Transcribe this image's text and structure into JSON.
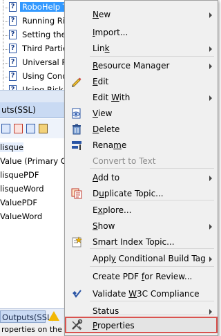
{
  "tree": {
    "items": [
      {
        "label": "RoboHelp Tu",
        "selected": true
      },
      {
        "label": "Running Risk",
        "selected": false
      },
      {
        "label": "Setting the Cu",
        "selected": false
      },
      {
        "label": "Third Parties a",
        "selected": false
      },
      {
        "label": "Universal Ref",
        "selected": false
      },
      {
        "label": "Using Conditio",
        "selected": false
      },
      {
        "label": "Using Risk Se",
        "selected": false
      }
    ],
    "doc_icon_glyph": "?"
  },
  "outputs_pane": {
    "title": "uts(SSL)",
    "items": [
      {
        "label": "lisque",
        "selected": true
      },
      {
        "label": "Value (Primary Output",
        "selected": false
      },
      {
        "label": "lisquePDF",
        "selected": false
      },
      {
        "label": "lisqueWord",
        "selected": false
      },
      {
        "label": "ValuePDF",
        "selected": false
      },
      {
        "label": "ValueWord",
        "selected": false
      }
    ]
  },
  "bottom_tab": {
    "label": "Outputs(SSL)"
  },
  "status_bar": {
    "text": "roperties on the s"
  },
  "context_menu": {
    "items": [
      {
        "label": "New",
        "accel": "N",
        "submenu": true,
        "icon": "",
        "disabled": false
      },
      {
        "label": "Import...",
        "accel": "I",
        "submenu": false,
        "icon": "",
        "disabled": false
      },
      {
        "label": "Link",
        "accel": "k",
        "submenu": true,
        "icon": "",
        "disabled": false
      },
      {
        "label": "Resource Manager",
        "accel": "R",
        "submenu": true,
        "icon": "",
        "disabled": false
      },
      {
        "label": "Edit",
        "accel": "E",
        "submenu": false,
        "icon": "pencil-icon",
        "disabled": false
      },
      {
        "label": "Edit With",
        "accel": "W",
        "submenu": true,
        "icon": "",
        "disabled": false
      },
      {
        "label": "View",
        "accel": "V",
        "submenu": false,
        "icon": "eye-document-icon",
        "disabled": false
      },
      {
        "label": "Delete",
        "accel": "D",
        "submenu": false,
        "icon": "trash-icon",
        "disabled": false
      },
      {
        "label": "Rename",
        "accel": "m",
        "submenu": false,
        "icon": "rename-icon",
        "disabled": false
      },
      {
        "label": "Convert to Text",
        "accel": "",
        "submenu": false,
        "icon": "",
        "disabled": true
      },
      {
        "label": "Add to",
        "accel": "A",
        "submenu": true,
        "icon": "",
        "disabled": false
      },
      {
        "label": "Duplicate Topic...",
        "accel": "u",
        "submenu": false,
        "icon": "duplicate-topic-icon",
        "disabled": false
      },
      {
        "label": "Explore...",
        "accel": "x",
        "submenu": false,
        "icon": "",
        "disabled": false
      },
      {
        "label": "Show",
        "accel": "S",
        "submenu": true,
        "icon": "",
        "disabled": false
      },
      {
        "label": "Smart Index Topic...",
        "accel": "",
        "submenu": false,
        "icon": "smart-index-icon",
        "disabled": false
      },
      {
        "label": "Apply Conditional Build Tag",
        "accel": "y",
        "submenu": true,
        "icon": "",
        "disabled": false
      },
      {
        "label": "Create PDF for Review...",
        "accel": "f",
        "submenu": false,
        "icon": "",
        "disabled": false
      },
      {
        "label": "Validate W3C Compliance",
        "accel": "W",
        "submenu": false,
        "icon": "validate-check-icon",
        "disabled": false
      },
      {
        "label": "Status",
        "accel": "",
        "submenu": true,
        "icon": "",
        "disabled": false
      },
      {
        "label": "Properties",
        "accel": "P",
        "submenu": false,
        "icon": "wrench-screwdriver-icon",
        "disabled": false
      }
    ],
    "highlighted_item": "Properties",
    "highlight_border_color": "#d9534f"
  },
  "colors": {
    "selection": "#3399ff",
    "menu_background": "#f0f0f0",
    "pane_header": "#c9daf3"
  }
}
